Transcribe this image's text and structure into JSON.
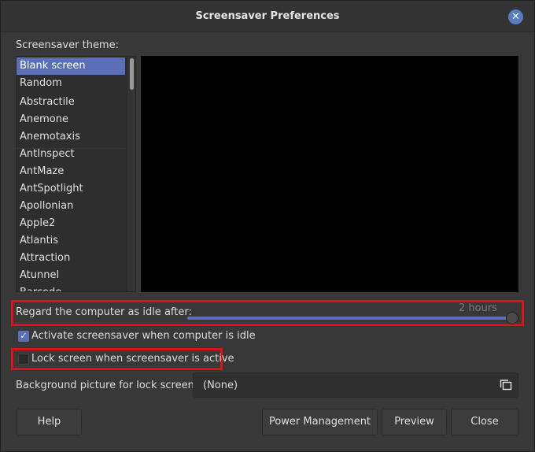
{
  "window": {
    "title": "Screensaver Preferences"
  },
  "theme_section": {
    "label": "Screensaver theme:",
    "selected": "Blank screen",
    "items": [
      "Blank screen",
      "Random",
      "Abstractile",
      "Anemone",
      "Anemotaxis",
      "AntInspect",
      "AntMaze",
      "AntSpotlight",
      "Apollonian",
      "Apple2",
      "Atlantis",
      "Attraction",
      "Atunnel",
      "Barcode"
    ]
  },
  "idle": {
    "label": "Regard the computer as idle after:",
    "value_text": "2 hours",
    "level_fraction": 1.0
  },
  "activate": {
    "label": "Activate screensaver when computer is idle",
    "checked": true
  },
  "lock": {
    "label": "Lock screen when screensaver is active",
    "checked": false
  },
  "background": {
    "label": "Background picture for lock screen:",
    "value": "(None)"
  },
  "buttons": {
    "help": "Help",
    "power": "Power Management",
    "preview": "Preview",
    "close": "Close"
  },
  "colors": {
    "accent": "#5b6fb8",
    "highlight": "#e0101b"
  }
}
